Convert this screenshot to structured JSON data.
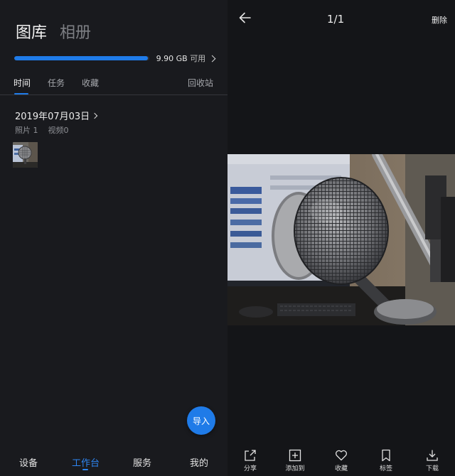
{
  "gallery": {
    "title_active": "图库",
    "title_inactive": "相册",
    "storage": {
      "used_fraction": 0.99,
      "free": "9.90 GB",
      "free_suffix": "可用"
    },
    "tabs": [
      "时间",
      "任务",
      "收藏"
    ],
    "recycle_bin": "回收站",
    "group": {
      "date": "2019年07月03日",
      "photos": "照片 1",
      "videos": "视频0"
    },
    "fab_label": "导入",
    "bottom_nav": [
      "设备",
      "工作台",
      "服务",
      "我的"
    ],
    "active_nav": "工作台",
    "accent_color": "#1f7be8"
  },
  "viewer": {
    "counter": "1/1",
    "delete_label": "删除",
    "toolbar": [
      {
        "icon": "share-icon",
        "label": "分享"
      },
      {
        "icon": "add-to-icon",
        "label": "添加到"
      },
      {
        "icon": "heart-icon",
        "label": "收藏"
      },
      {
        "icon": "bookmark-icon",
        "label": "标签"
      },
      {
        "icon": "download-icon",
        "label": "下载"
      }
    ]
  }
}
